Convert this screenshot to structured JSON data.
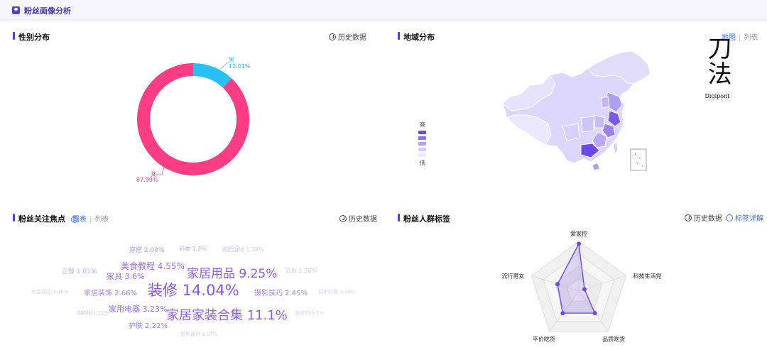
{
  "header": {
    "title": "粉丝画像分析"
  },
  "gender": {
    "title": "性别分布",
    "history": "历史数据",
    "male": {
      "label": "男",
      "pct": "12.01%",
      "value": 12.01,
      "color": "#29c0f5"
    },
    "female": {
      "label": "女",
      "pct": "87.99%",
      "value": 87.99,
      "color": "#ff3d85"
    }
  },
  "region": {
    "title": "地域分布",
    "toggle": {
      "map": "地图",
      "list": "列表"
    },
    "legend": {
      "high": "高",
      "low": "低"
    },
    "legend_colors": [
      "#6c49e6",
      "#8b6ef0",
      "#b09ef5",
      "#d4cbfa",
      "#ece8fd"
    ]
  },
  "watermark": {
    "chars": "刀法",
    "brand": "Digipont"
  },
  "focus": {
    "title": "粉丝关注焦点",
    "toggle": {
      "chart": "图表",
      "list": "列表"
    },
    "history": "历史数据",
    "words": [
      {
        "text": "穿搭 2.04%",
        "size": 9,
        "color": "#b69af5"
      },
      {
        "text": "彩妆 1.9%",
        "size": 8,
        "color": "#c3adf7"
      },
      {
        "text": "减肥运动 1.34%",
        "size": 8,
        "color": "#d3c3f9"
      },
      {
        "text": "美食教程 4.55%",
        "size": 12,
        "color": "#9b6ef2"
      },
      {
        "text": "家居用品 9.25%",
        "size": 17,
        "color": "#8d5cf0"
      },
      {
        "text": "正餐 1.81%",
        "size": 9,
        "color": "#c3adf7"
      },
      {
        "text": "家具 3.6%",
        "size": 11,
        "color": "#9b6ef2"
      },
      {
        "text": "去处 1.26%",
        "size": 8,
        "color": "#d3c3f9"
      },
      {
        "text": "美食探店 1.16%",
        "size": 7,
        "color": "#dccdfa"
      },
      {
        "text": "家居装饰 2.66%",
        "size": 10,
        "color": "#a884f3"
      },
      {
        "text": "装修 14.04%",
        "size": 21,
        "color": "#8652ef"
      },
      {
        "text": "摄影技巧 2.45%",
        "size": 10,
        "color": "#a884f3"
      },
      {
        "text": "知识科普 1.12%",
        "size": 7,
        "color": "#dccdfa"
      },
      {
        "text": "购物地 1.21%",
        "size": 7,
        "color": "#d3c3f9"
      },
      {
        "text": "家用电器 3.23%",
        "size": 11,
        "color": "#9b6ef2"
      },
      {
        "text": "家居家装合集 11.1%",
        "size": 18,
        "color": "#8d5cf0"
      },
      {
        "text": "装修知识 1%",
        "size": 7,
        "color": "#dccdfa"
      },
      {
        "text": "护肤 2.22%",
        "size": 10,
        "color": "#a884f3"
      },
      {
        "text": "摄影器材 1.07%",
        "size": 7,
        "color": "#dccdfa"
      }
    ]
  },
  "tags": {
    "title": "粉丝人群标签",
    "history": "历史数据",
    "detail": "标签详解",
    "axes": [
      "爱家控",
      "科技生活党",
      "品质吃货",
      "平价吃货",
      "流行男女"
    ],
    "values": [
      0.95,
      0.12,
      0.55,
      0.55,
      0.45
    ],
    "color": "#6c49e6"
  }
}
